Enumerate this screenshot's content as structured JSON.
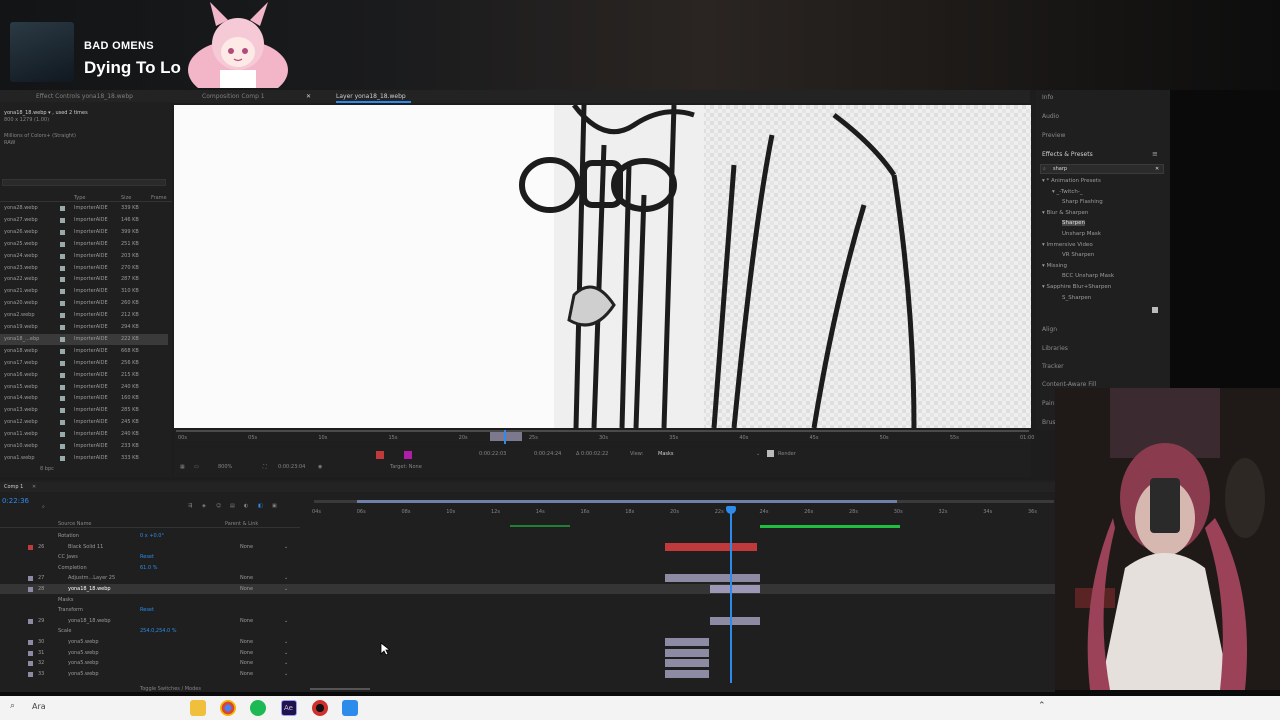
{
  "stream": {
    "now_playing_artist": "BAD OMENS",
    "now_playing_title": "Dying To Lo"
  },
  "project_panel": {
    "tabs": [
      "Effect Controls yona18_18.webp",
      "Composition Comp 1",
      "Layer yona18_18.webp"
    ],
    "info_line1": "yona18_18.webp ▾ , used 2 times",
    "info_line2": "800 x 1279 (1.00)",
    "info_line3": "Millions of Colors+ (Straight)",
    "info_line4": "RAW",
    "columns": [
      "Type",
      "Size",
      "Frame"
    ],
    "items": [
      {
        "name": "yona28.webp",
        "type": "ImporterAIDE",
        "size": "339 KB"
      },
      {
        "name": "yona27.webp",
        "type": "ImporterAIDE",
        "size": "146 KB"
      },
      {
        "name": "yona26.webp",
        "type": "ImporterAIDE",
        "size": "399 KB"
      },
      {
        "name": "yona25.webp",
        "type": "ImporterAIDE",
        "size": "251 KB"
      },
      {
        "name": "yona24.webp",
        "type": "ImporterAIDE",
        "size": "203 KB"
      },
      {
        "name": "yona23.webp",
        "type": "ImporterAIDE",
        "size": "270 KB"
      },
      {
        "name": "yona22.webp",
        "type": "ImporterAIDE",
        "size": "287 KB"
      },
      {
        "name": "yona21.webp",
        "type": "ImporterAIDE",
        "size": "310 KB"
      },
      {
        "name": "yona20.webp",
        "type": "ImporterAIDE",
        "size": "260 KB"
      },
      {
        "name": "yona2.webp",
        "type": "ImporterAIDE",
        "size": "212 KB"
      },
      {
        "name": "yona19.webp",
        "type": "ImporterAIDE",
        "size": "294 KB"
      },
      {
        "name": "yona18_...ebp",
        "type": "ImporterAIDE",
        "size": "222 KB"
      },
      {
        "name": "yona18.webp",
        "type": "ImporterAIDE",
        "size": "668 KB"
      },
      {
        "name": "yona17.webp",
        "type": "ImporterAIDE",
        "size": "256 KB"
      },
      {
        "name": "yona16.webp",
        "type": "ImporterAIDE",
        "size": "215 KB"
      },
      {
        "name": "yona15.webp",
        "type": "ImporterAIDE",
        "size": "240 KB"
      },
      {
        "name": "yona14.webp",
        "type": "ImporterAIDE",
        "size": "160 KB"
      },
      {
        "name": "yona13.webp",
        "type": "ImporterAIDE",
        "size": "285 KB"
      },
      {
        "name": "yona12.webp",
        "type": "ImporterAIDE",
        "size": "245 KB"
      },
      {
        "name": "yona11.webp",
        "type": "ImporterAIDE",
        "size": "240 KB"
      },
      {
        "name": "yona10.webp",
        "type": "ImporterAIDE",
        "size": "233 KB"
      },
      {
        "name": "yona1.webp",
        "type": "ImporterAIDE",
        "size": "333 KB"
      }
    ],
    "bit_depth": "8 bpc"
  },
  "viewer": {
    "ruler_labels": [
      "00s",
      "05s",
      "10s",
      "15s",
      "20s",
      "25s",
      "30s",
      "35s",
      "40s",
      "45s",
      "50s",
      "55s",
      "01:00"
    ],
    "zoom": "800%",
    "current_time": "0:00:23:04",
    "target": "Target: None",
    "in_time": "0:00:22:03",
    "out_time": "0:00:24:24",
    "duration": "Δ 0:00:02:22",
    "view_label": "View:",
    "view_value": "Masks",
    "render_label": "Render"
  },
  "right_panel": {
    "items_top": [
      "Info",
      "Audio",
      "Preview"
    ],
    "effects_title": "Effects & Presets",
    "search_value": "sharp",
    "tree": [
      {
        "label": "▾ * Animation Presets",
        "depth": 0
      },
      {
        "label": "▾ _-Twitch-_",
        "depth": 1
      },
      {
        "label": "Sharp Flashing",
        "depth": 2
      },
      {
        "label": "▾ Blur & Sharpen",
        "depth": 0
      },
      {
        "label": "Sharpen",
        "depth": 2,
        "selected": true
      },
      {
        "label": "Unsharp Mask",
        "depth": 2
      },
      {
        "label": "▾ Immersive Video",
        "depth": 0
      },
      {
        "label": "VR Sharpen",
        "depth": 2
      },
      {
        "label": "▾ Missing",
        "depth": 0
      },
      {
        "label": "BCC Unsharp Mask",
        "depth": 2
      },
      {
        "label": "▾ Sapphire Blur+Sharpen",
        "depth": 0
      },
      {
        "label": "S_Sharpen",
        "depth": 2
      }
    ],
    "items_bottom": [
      "Align",
      "Libraries",
      "Tracker",
      "Content-Aware Fill",
      "Pain",
      "Brus"
    ]
  },
  "timeline": {
    "comp_tab": "Comp 1",
    "timecode": "0:22:36",
    "columns": [
      "Source Name",
      "Parent & Link"
    ],
    "ruler_labels": [
      "04s",
      "06s",
      "08s",
      "10s",
      "12s",
      "14s",
      "16s",
      "18s",
      "20s",
      "22s",
      "24s",
      "26s",
      "28s",
      "30s",
      "32s",
      "34s",
      "36s"
    ],
    "rows": [
      {
        "num": "",
        "name": "Rotation",
        "value": "0 x +0.0°",
        "parent": ""
      },
      {
        "num": "26",
        "name": "Black Solid 11",
        "parent": "None"
      },
      {
        "num": "",
        "name": "CC Jaws",
        "value": "Reset",
        "parent": ""
      },
      {
        "num": "",
        "name": "Completion",
        "value": "61.0 %",
        "parent": ""
      },
      {
        "num": "27",
        "name": "Adjustm...Layer 25",
        "parent": "None"
      },
      {
        "num": "28",
        "name": "yona18_18.webp",
        "parent": "None"
      },
      {
        "num": "",
        "name": "Masks",
        "parent": ""
      },
      {
        "num": "",
        "name": "Transform",
        "value": "Reset",
        "parent": ""
      },
      {
        "num": "29",
        "name": "yona18_18.webp",
        "parent": "None"
      },
      {
        "num": "",
        "name": "Scale",
        "value": "254.0,254.0 %",
        "parent": ""
      },
      {
        "num": "30",
        "name": "yona5.webp",
        "parent": "None"
      },
      {
        "num": "31",
        "name": "yona5.webp",
        "parent": "None"
      },
      {
        "num": "32",
        "name": "yona5.webp",
        "parent": "None"
      },
      {
        "num": "33",
        "name": "yona5.webp",
        "parent": "None"
      }
    ],
    "footer": "Toggle Switches / Modes"
  },
  "taskbar": {
    "search_text": "Ara"
  },
  "colors": {
    "accent_blue": "#2d8ceb",
    "label_red": "#c0393b",
    "label_gray": "#8d8aa3",
    "workarea_green": "#1fbf3f"
  }
}
